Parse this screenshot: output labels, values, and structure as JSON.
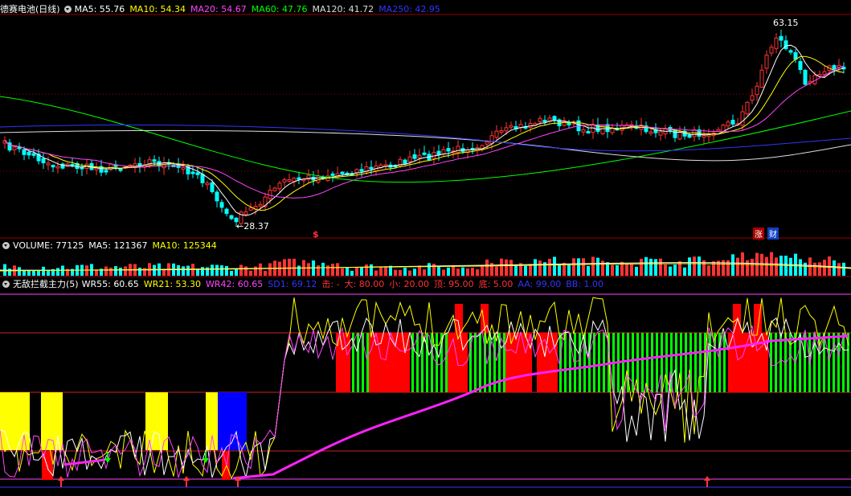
{
  "colors": {
    "ma5": "#ffffff",
    "ma10": "#ffff00",
    "ma20": "#ff44ff",
    "ma60": "#00ff00",
    "ma120": "#dddddd",
    "ma250": "#3333ff",
    "up": "#ff3333",
    "down": "#00ffff",
    "grid": "#990000"
  },
  "price_panel": {
    "title": "德赛电池(日线)",
    "indicators": [
      {
        "label": "MA5: 55.76",
        "color": "#ffffff"
      },
      {
        "label": "MA10: 54.34",
        "color": "#ffff00"
      },
      {
        "label": "MA20: 54.67",
        "color": "#ff44ff"
      },
      {
        "label": "MA60: 47.76",
        "color": "#00ff00"
      },
      {
        "label": "MA120: 41.72",
        "color": "#dddddd"
      },
      {
        "label": "MA250: 42.95",
        "color": "#3333ff"
      }
    ],
    "high_label": "63.15",
    "low_label": "28.37",
    "markers": [
      {
        "text": "$",
        "color": "#ff3333"
      },
      {
        "text": "涨",
        "color": "#ffffff"
      },
      {
        "text": "财",
        "color": "#ffffff"
      }
    ]
  },
  "volume_panel": {
    "indicators": [
      {
        "label": "VOLUME: 77125",
        "color": "#ffffff"
      },
      {
        "label": "MA5: 121367",
        "color": "#ffffff"
      },
      {
        "label": "MA10: 125344",
        "color": "#ffff00"
      }
    ]
  },
  "indicator_panel": {
    "title": "无敌拦截主力(5)",
    "indicators": [
      {
        "label": "WR55: 60.65",
        "color": "#ffffff"
      },
      {
        "label": "WR21: 53.30",
        "color": "#ffff00"
      },
      {
        "label": "WR42: 60.65",
        "color": "#ff44ff"
      },
      {
        "label": "SD1: 69.12",
        "color": "#3333ff"
      },
      {
        "label": "击: -",
        "color": "#ff3333"
      },
      {
        "label": "大: 80.00",
        "color": "#ff3333"
      },
      {
        "label": "小: 20.00",
        "color": "#ff3333"
      },
      {
        "label": "顶: 95.00",
        "color": "#ff3333"
      },
      {
        "label": "底: 5.00",
        "color": "#ff3333"
      },
      {
        "label": "AA: 99.00",
        "color": "#3333ff"
      },
      {
        "label": "BB: 1.00",
        "color": "#3333ff"
      }
    ]
  }
}
